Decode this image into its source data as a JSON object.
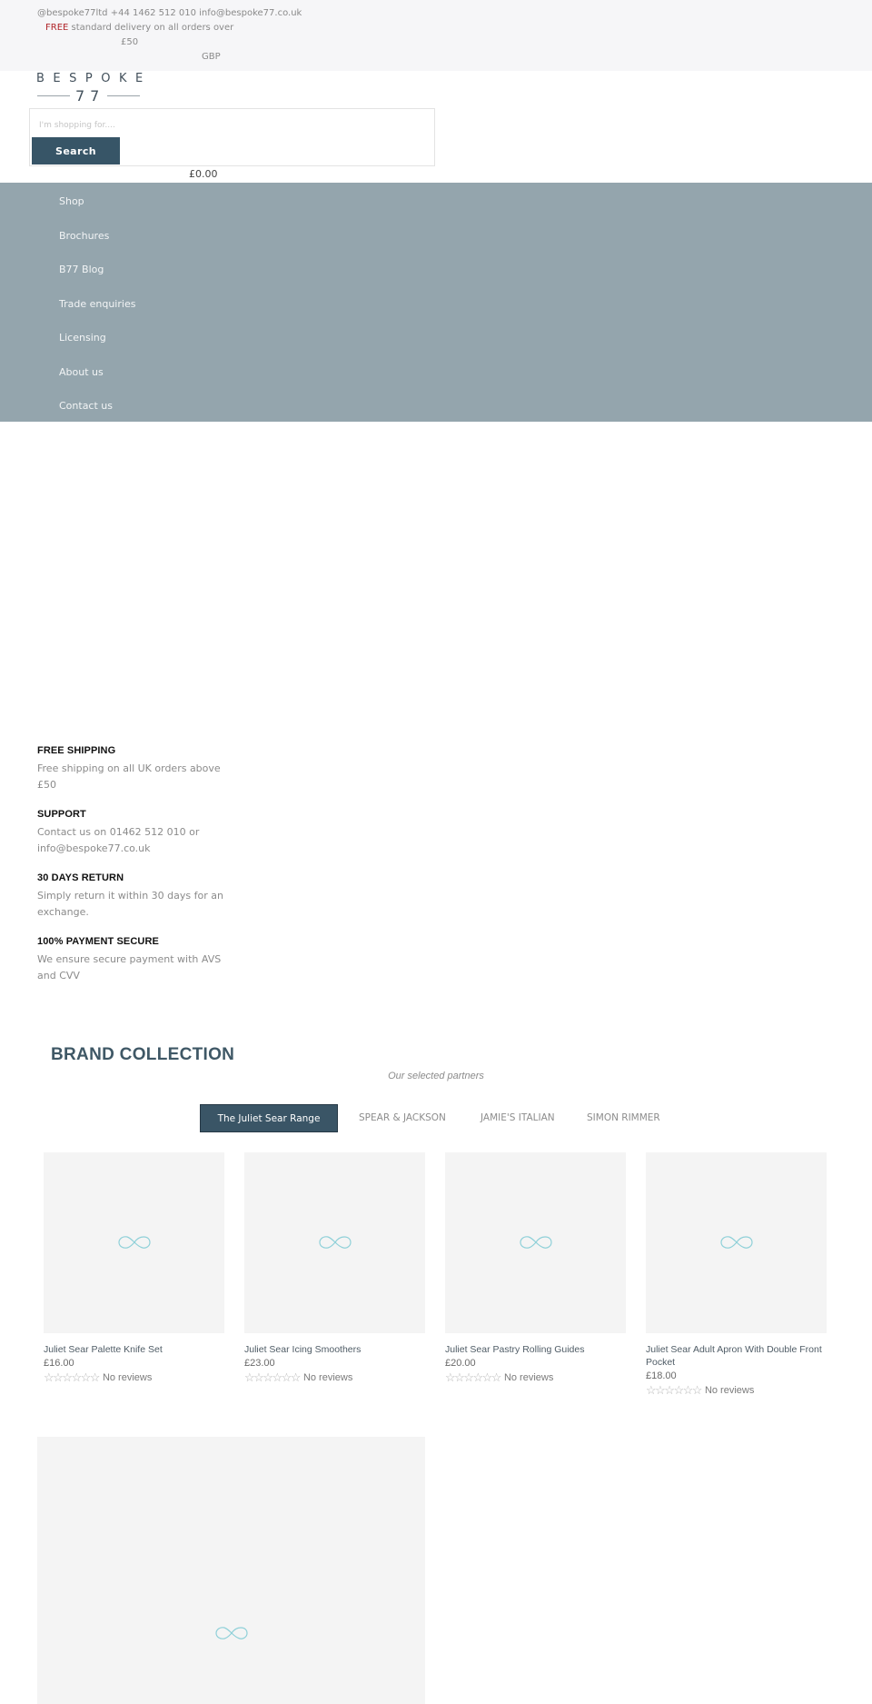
{
  "topbar": {
    "contact": "@bespoke77ltd +44 1462 512 010 info@bespoke77.co.uk",
    "delivery_highlight": "FREE",
    "delivery_text": " standard delivery on all orders over",
    "delivery_threshold": "£50",
    "currency": "GBP"
  },
  "logo": {
    "word": "BESPOKE",
    "number": "77"
  },
  "search": {
    "placeholder": "I'm shopping for....",
    "value": "",
    "button_label": "Search"
  },
  "cart": {
    "total": "£0.00"
  },
  "nav": {
    "items": [
      {
        "label": "Shop"
      },
      {
        "label": "Brochures"
      },
      {
        "label": "B77 Blog"
      },
      {
        "label": "Trade enquiries"
      },
      {
        "label": "Licensing"
      },
      {
        "label": "About us"
      },
      {
        "label": "Contact us"
      }
    ]
  },
  "features": [
    {
      "title": "FREE SHIPPING",
      "text": "Free shipping on all UK orders above £50"
    },
    {
      "title": "SUPPORT",
      "text": "Contact us on 01462 512 010 or info@bespoke77.co.uk"
    },
    {
      "title": "30 DAYS RETURN",
      "text": "Simply return it within 30 days for an exchange."
    },
    {
      "title": "100% PAYMENT SECURE",
      "text": "We ensure secure payment with AVS and CVV"
    }
  ],
  "brand_collection": {
    "title": "BRAND COLLECTION",
    "subtitle": "Our selected partners",
    "tabs": [
      {
        "label": "The Juliet Sear Range",
        "active": true
      },
      {
        "label": "SPEAR & JACKSON",
        "active": false
      },
      {
        "label": "JAMIE'S ITALIAN",
        "active": false
      },
      {
        "label": "SIMON RIMMER",
        "active": false
      }
    ],
    "products": [
      {
        "title": "Juliet Sear Palette Knife Set",
        "price": "£16.00",
        "rating": 0,
        "rating_max": 6,
        "reviews": "No reviews"
      },
      {
        "title": "Juliet Sear Icing Smoothers",
        "price": "£23.00",
        "rating": 0,
        "rating_max": 6,
        "reviews": "No reviews"
      },
      {
        "title": "Juliet Sear Pastry Rolling Guides",
        "price": "£20.00",
        "rating": 0,
        "rating_max": 6,
        "reviews": "No reviews"
      },
      {
        "title": "Juliet Sear Adult Apron With Double Front Pocket",
        "price": "£18.00",
        "rating": 0,
        "rating_max": 6,
        "reviews": "No reviews"
      }
    ]
  },
  "icons": {
    "loading": "infinity-loader-icon",
    "star_empty": "☆"
  },
  "colors": {
    "brand_dark": "#375567",
    "nav_bg": "#94a5ad",
    "free_red": "#b0252a",
    "loader": "#8fd0d8"
  }
}
